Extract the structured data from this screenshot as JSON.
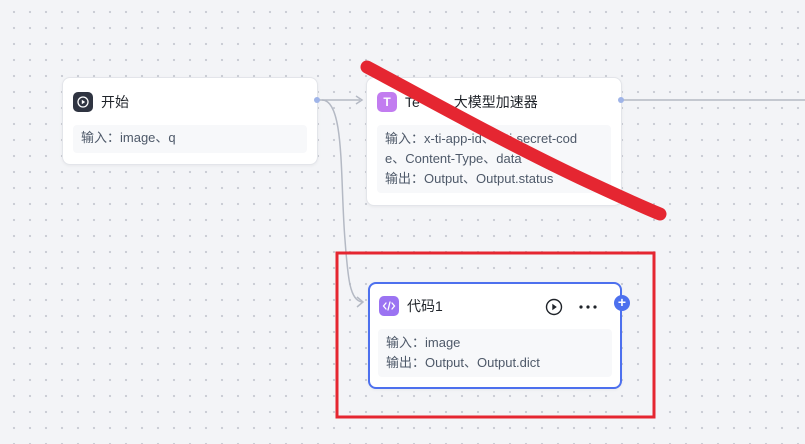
{
  "nodes": {
    "start": {
      "title": "开始",
      "input_line": "输入：image、q",
      "icon": "play-icon"
    },
    "llm": {
      "title": "Te⋯ 大模型加速器",
      "title_visible_suffix": "大模型加速器",
      "title_visible_prefix": "Te",
      "input_line_1": "输入：x-ti-app-id、x-ti-secret-cod",
      "input_line_2": "e、Content-Type、data",
      "output_line": "输出：Output、Output.status",
      "icon": "t-letter-icon"
    },
    "code": {
      "title": "代码1",
      "input_line": "输入：image",
      "output_line": "输出：Output、Output.dict",
      "icon": "code-icon",
      "run_icon": "play-circle-icon",
      "more_icon": "more-icon",
      "add_icon": "plus-icon"
    }
  },
  "colors": {
    "accent": "#4d70ee",
    "llm_icon_bg": "#c27cf0",
    "code_icon_bg": "#9b73f2",
    "start_icon_bg": "#2f3441",
    "annotation_red": "#e52631",
    "edge": "#b4b9c4"
  }
}
